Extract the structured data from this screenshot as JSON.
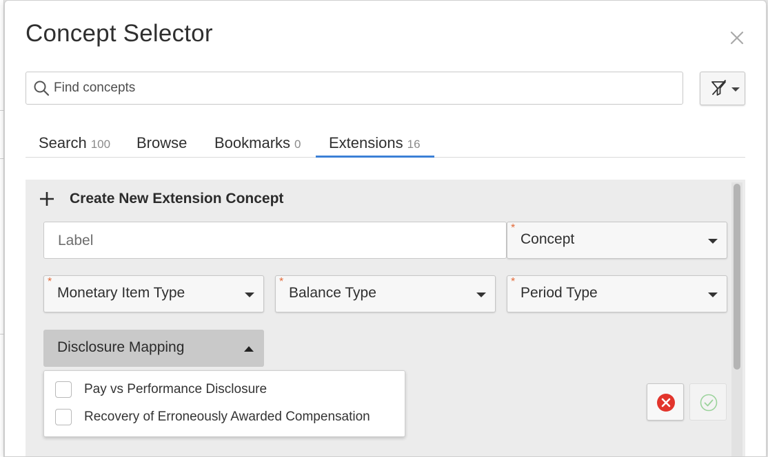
{
  "dialog": {
    "title": "Concept Selector"
  },
  "search": {
    "placeholder": "Find concepts"
  },
  "tabs": [
    {
      "label": "Search",
      "count": "100"
    },
    {
      "label": "Browse",
      "count": ""
    },
    {
      "label": "Bookmarks",
      "count": "0"
    },
    {
      "label": "Extensions",
      "count": "16",
      "active": true
    }
  ],
  "create": {
    "label": "Create New Extension Concept"
  },
  "form": {
    "label_placeholder": "Label",
    "concept": "Concept",
    "item_type": "Monetary Item Type",
    "balance_type": "Balance Type",
    "period_type": "Period Type",
    "required_marker": "*"
  },
  "mapping": {
    "label": "Disclosure Mapping",
    "options": [
      {
        "label": "Pay vs Performance Disclosure",
        "checked": false
      },
      {
        "label": "Recovery of Erroneously Awarded Compensation",
        "checked": false
      }
    ]
  },
  "icons": {
    "close": "close-icon",
    "search": "search-icon",
    "filter": "filter-off-icon",
    "plus": "plus-icon",
    "cancel": "cancel-circle-icon",
    "confirm": "check-circle-icon"
  },
  "colors": {
    "accent": "#3b7fd6",
    "required": "#e36b3a",
    "cancel": "#e2352c",
    "confirm": "#9bd39b"
  }
}
